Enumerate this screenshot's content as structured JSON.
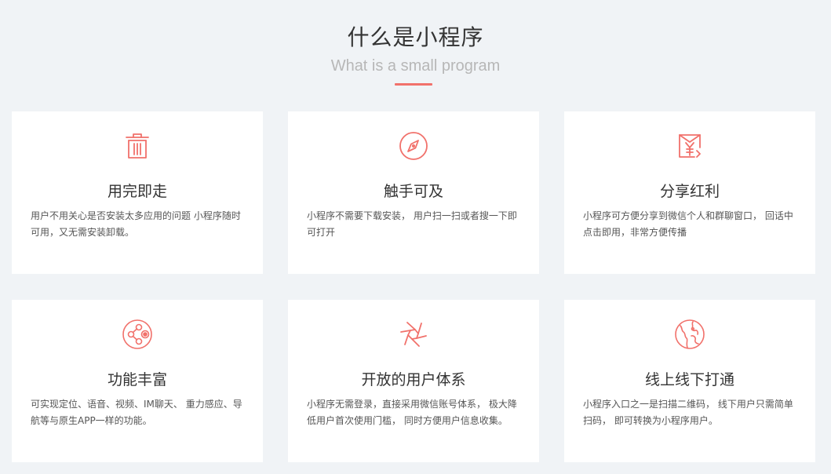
{
  "header": {
    "title": "什么是小程序",
    "subtitle": "What is a small program"
  },
  "accent_color": "#f1716b",
  "cards": [
    {
      "icon": "trash-bin-icon",
      "title": "用完即走",
      "desc": "用户不用关心是否安装太多应用的问题 小程序随时可用，又无需安装卸载。"
    },
    {
      "icon": "compass-icon",
      "title": "触手可及",
      "desc": "小程序不需要下载安装， 用户扫一扫或者搜一下即可打开"
    },
    {
      "icon": "red-envelope-icon",
      "title": "分享红利",
      "desc": "小程序可方便分享到微信个人和群聊窗口， 回话中点击即用，非常方便传播"
    },
    {
      "icon": "share-network-icon",
      "title": "功能丰富",
      "desc": "可实现定位、语音、视频、IM聊天、 重力感应、导航等与原生APP一样的功能。"
    },
    {
      "icon": "aperture-icon",
      "title": "开放的用户体系",
      "desc": "小程序无需登录，直接采用微信账号体系， 极大降低用户首次使用门槛， 同时方便用户信息收集。"
    },
    {
      "icon": "globe-icon",
      "title": "线上线下打通",
      "desc": "小程序入口之一是扫描二维码， 线下用户只需简单扫码， 即可转换为小程序用户。"
    }
  ]
}
